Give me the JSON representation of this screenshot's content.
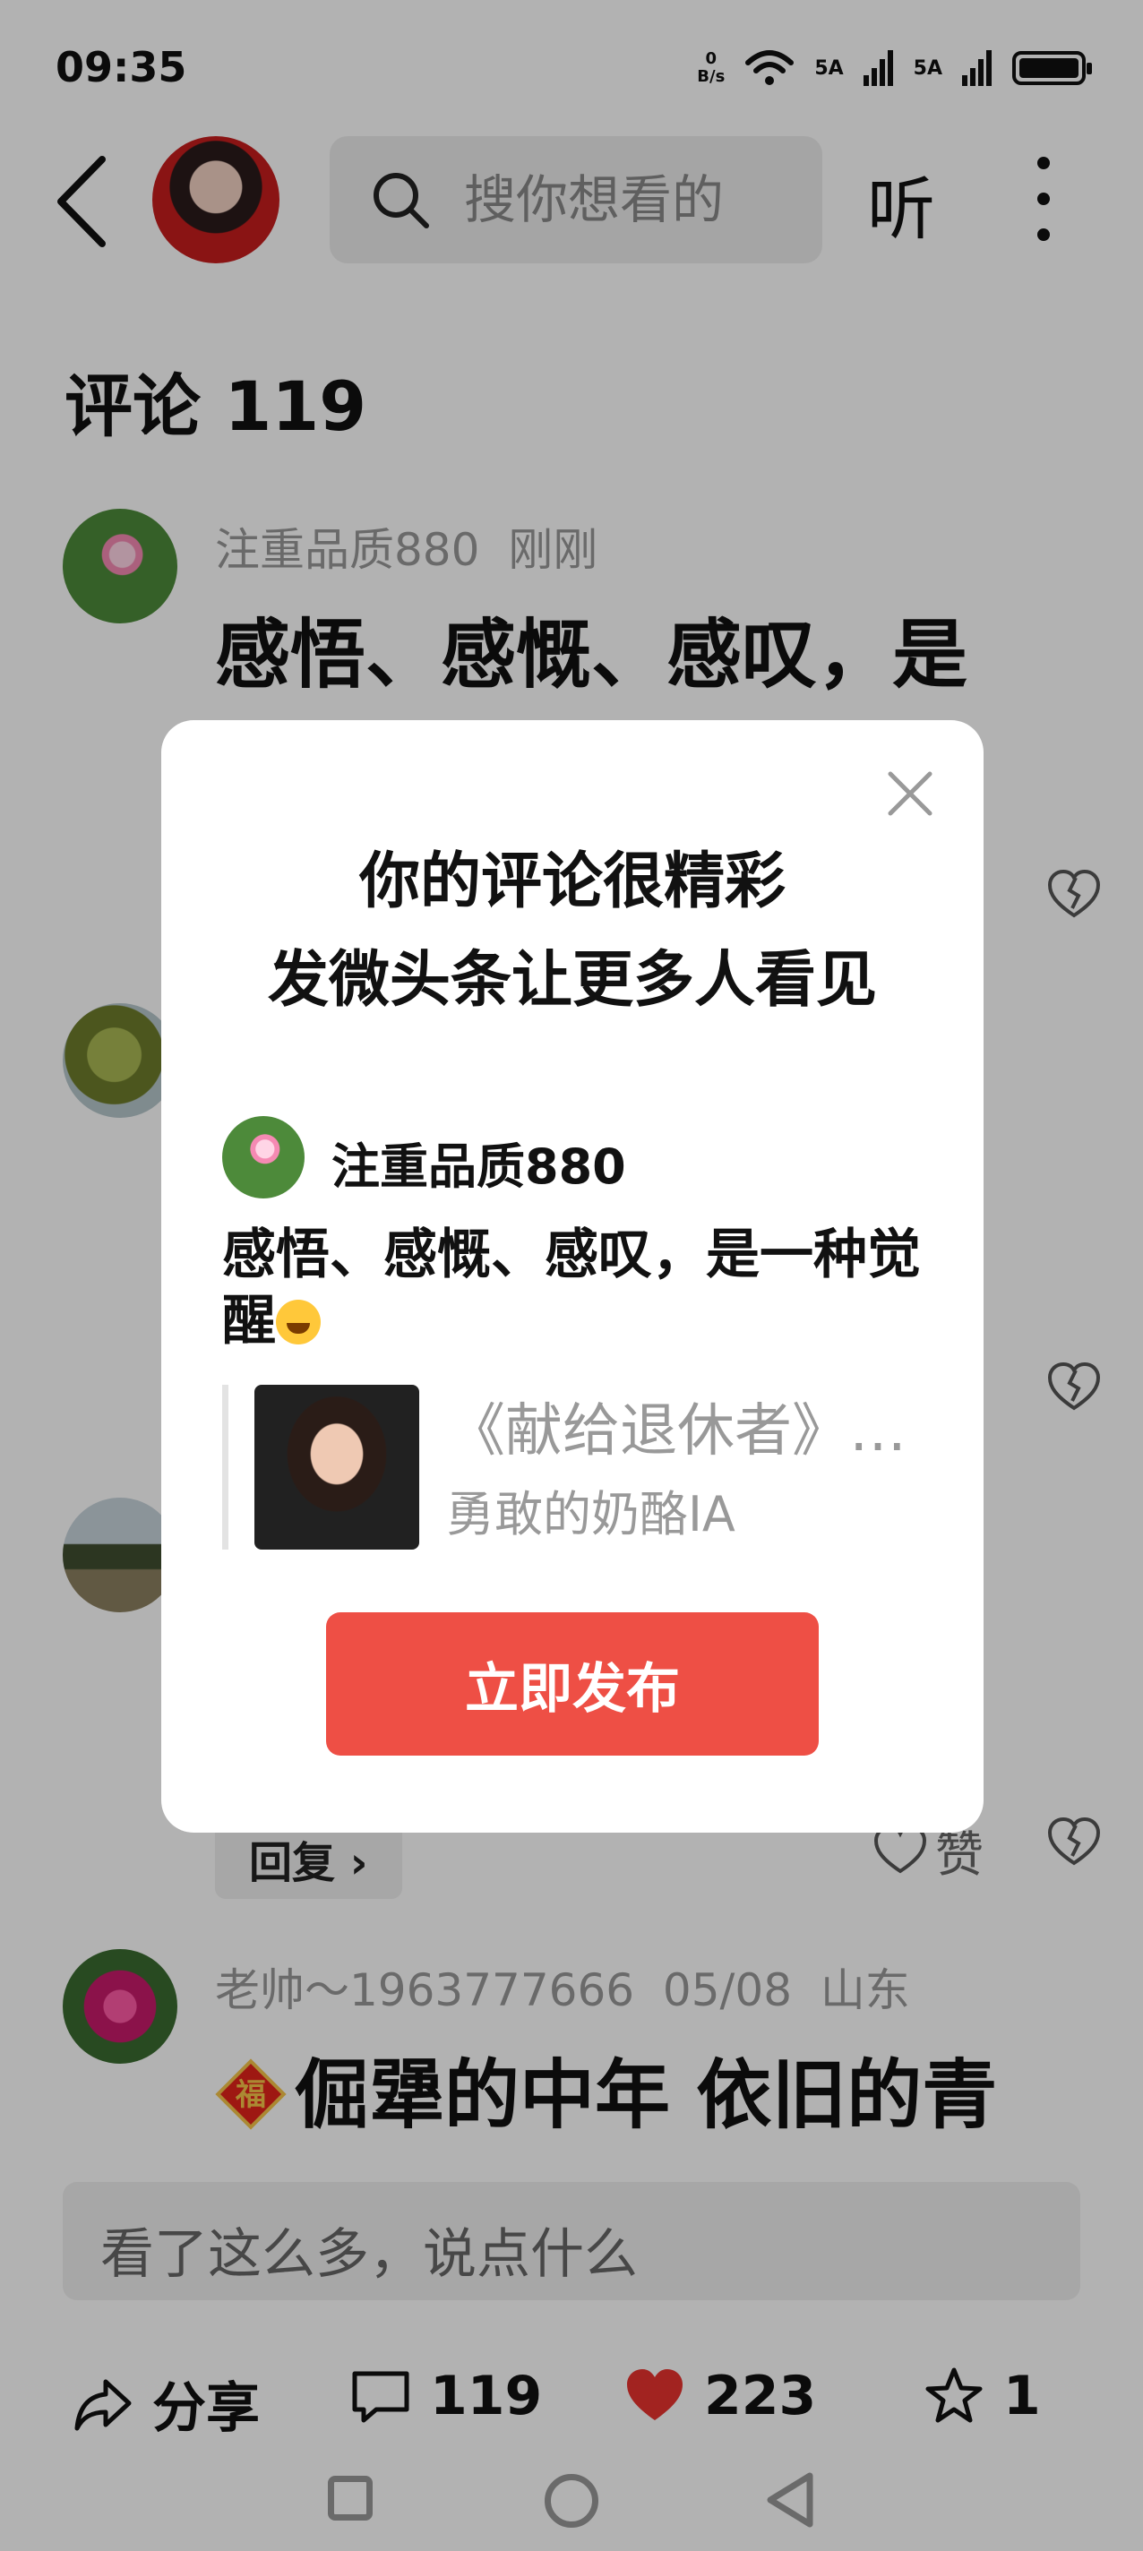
{
  "status_bar": {
    "time": "09:35",
    "net_speed_value": "0",
    "net_speed_unit": "B/s",
    "signal_1": "5A",
    "signal_2": "5A",
    "battery_level": 1.0
  },
  "header": {
    "search_placeholder": "搜你想看的",
    "listen_label": "听"
  },
  "comments_title": "评论 119",
  "comments": [
    {
      "user": "注重品质880",
      "time": "刚刚",
      "text": "感悟、感慨、感叹，是"
    },
    {
      "reply_label": "回复",
      "like_label": "赞"
    },
    {
      "user": "老帅～1963777666",
      "time": "05/08",
      "location": "山东",
      "badge": "福",
      "text": "倔犟的中年  依旧的青"
    }
  ],
  "input": {
    "placeholder": "看了这么多，说点什么"
  },
  "actions": {
    "share": "分享",
    "comments": "119",
    "likes": "223",
    "favorites": "1"
  },
  "modal": {
    "title_line1": "你的评论很精彩",
    "title_line2": "发微头条让更多人看见",
    "user": "注重品质880",
    "comment": "感悟、感慨、感叹，是一种觉醒",
    "quote_title": "《献给退休者》…",
    "quote_author": "勇敢的奶酪IA",
    "publish_button": "立即发布"
  },
  "colors": {
    "accent": "#ee4f45",
    "like_red": "#e8332f"
  }
}
